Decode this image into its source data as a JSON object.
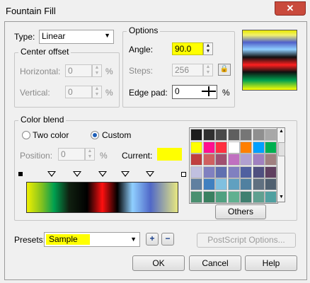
{
  "window": {
    "title": "Fountain Fill",
    "close_label": "✕"
  },
  "type": {
    "label": "Type:",
    "value": "Linear"
  },
  "center_offset": {
    "label": "Center offset",
    "horizontal_label": "Horizontal:",
    "horizontal_value": "0",
    "horizontal_unit": "%",
    "vertical_label": "Vertical:",
    "vertical_value": "0",
    "vertical_unit": "%"
  },
  "options": {
    "label": "Options",
    "angle_label": "Angle:",
    "angle_value": "90.0",
    "steps_label": "Steps:",
    "steps_value": "256",
    "edge_pad_label": "Edge pad:",
    "edge_pad_value": "0",
    "edge_pad_unit": "%"
  },
  "color_blend": {
    "label": "Color blend",
    "two_color_label": "Two color",
    "custom_label": "Custom",
    "selected_mode": "custom",
    "position_label": "Position:",
    "position_value": "0",
    "position_unit": "%",
    "current_label": "Current:",
    "current_color": "#ffff00",
    "gradient_colors": [
      "#ffff00",
      "#00a050",
      "#000000",
      "#ff0000",
      "#000000",
      "#8ed0ff",
      "#4a62c8",
      "#f0f080"
    ],
    "others_button": "Others"
  },
  "palette": [
    "#1c1c1c",
    "#303030",
    "#4a4a4a",
    "#5f5f5f",
    "#767676",
    "#8f8f8f",
    "#a8a8a8",
    "#ffff00",
    "#ff1090",
    "#ff3040",
    "#ffffff",
    "#ff8000",
    "#00a0ff",
    "#00b050",
    "#c04040",
    "#d06060",
    "#a05070",
    "#c070c0",
    "#b0a0d0",
    "#a080c0",
    "#a08080",
    "#c0c0e0",
    "#8080c0",
    "#6070b0",
    "#8080c0",
    "#5060a0",
    "#505080",
    "#604060",
    "#6080a0",
    "#4080c0",
    "#80c0e0",
    "#60a0c0",
    "#5080a0",
    "#607080",
    "#506070",
    "#4a9070",
    "#3a8060",
    "#50a080",
    "#60b090",
    "#408070",
    "#60a090",
    "#50a0a0"
  ],
  "presets": {
    "label": "Presets:",
    "value": "Sample",
    "add_label": "+",
    "remove_label": "−"
  },
  "buttons": {
    "postscript": "PostScript Options...",
    "ok": "OK",
    "cancel": "Cancel",
    "help": "Help"
  }
}
